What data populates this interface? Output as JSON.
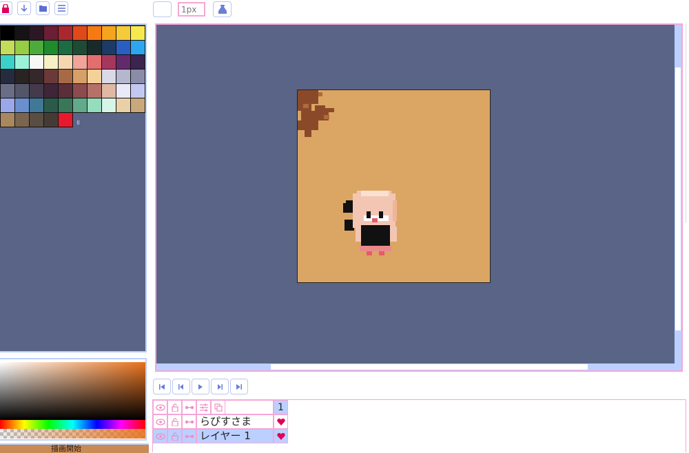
{
  "colors": {
    "accent_pink": "#f5a6d8",
    "accent_blue": "#bcd0ff",
    "workspace_bg": "#5a6486",
    "canvas_fill": "#dba664",
    "heart": "#e0005a"
  },
  "toolbar": {
    "icons": [
      "lock-icon",
      "download-icon",
      "folder-icon",
      "menu-icon"
    ]
  },
  "canvas_toolbar": {
    "brush_size_placeholder": "1px",
    "icons": [
      "blank-tool-icon",
      "bucket-fill-icon"
    ]
  },
  "palette": {
    "colors": [
      "#000000",
      "#151316",
      "#2b1824",
      "#6b1e34",
      "#ab2730",
      "#e04a1a",
      "#f57a14",
      "#f6a31d",
      "#f6cb3a",
      "#f7e84e",
      "#c3dc5a",
      "#96cd44",
      "#4daa3c",
      "#1e8b2c",
      "#1d6b40",
      "#1f4a34",
      "#1a2a2a",
      "#1c3a66",
      "#2a5ec2",
      "#2ea5ef",
      "#3bd1c9",
      "#9cf2d9",
      "#f7f7f5",
      "#f6f0c4",
      "#f6d6b0",
      "#f0a49a",
      "#e46e6e",
      "#a6375c",
      "#632a6b",
      "#3b244d",
      "#272b3e",
      "#292323",
      "#35282b",
      "#6b3a38",
      "#a86a44",
      "#d6a068",
      "#f3d199",
      "#d9d9e8",
      "#b5b7cf",
      "#8a8ca8",
      "#6a6d86",
      "#535569",
      "#443a4c",
      "#3e2537",
      "#5a2f3a",
      "#8c4b4c",
      "#b67268",
      "#e1b8a3",
      "#e9e9f7",
      "#c3c8f2",
      "#9aa7ea",
      "#6a8fcf",
      "#407898",
      "#2a5b4a",
      "#39775a",
      "#62aa8a",
      "#94ddbd",
      "#d7f4e9",
      "#ead0a8",
      "#c9a879",
      "#a98860",
      "#7a6550",
      "#5a4d44",
      "#453b36",
      "#e8192c"
    ],
    "handle_glyph": "॥"
  },
  "color_picker": {
    "current_hue": "#e8721c"
  },
  "bottom_tab": {
    "label": "描画開始"
  },
  "frame_controls": {
    "buttons": [
      "first-frame-icon",
      "prev-frame-icon",
      "play-icon",
      "next-frame-icon",
      "last-frame-icon"
    ]
  },
  "layers": {
    "frame_number": "1",
    "header_icons": [
      "eye-icon",
      "lock-open-icon",
      "link-icon",
      "adjust-icon",
      "duplicate-icon"
    ],
    "rows": [
      {
        "name": "らぴすさま",
        "selected": false
      },
      {
        "name": "レイヤー 1",
        "selected": true
      }
    ]
  }
}
